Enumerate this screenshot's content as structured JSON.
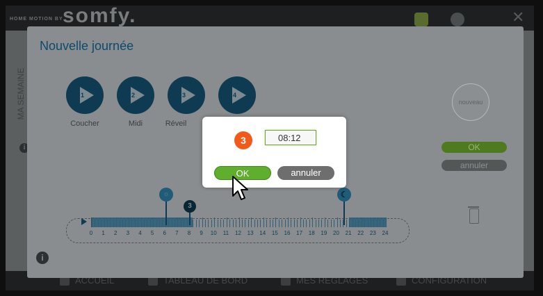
{
  "header": {
    "tagline": "HOME MOTION BY",
    "brand": "somfy."
  },
  "side_tab": "MA SEMAINE",
  "panel": {
    "title": "Nouvelle journée",
    "slots": [
      {
        "number": "1",
        "label": "Coucher"
      },
      {
        "number": "2",
        "label": "Midi"
      },
      {
        "number": "3",
        "label": "Réveil"
      },
      {
        "number": "4",
        "label": ""
      }
    ],
    "new_button": "nouveau",
    "ok_button": "OK",
    "cancel_button": "annuler",
    "timeline": {
      "hours": [
        "0",
        "1",
        "2",
        "3",
        "4",
        "5",
        "6",
        "7",
        "8",
        "9",
        "10",
        "11",
        "12",
        "13",
        "14",
        "15",
        "16",
        "17",
        "18",
        "19",
        "20",
        "21",
        "22",
        "23",
        "24"
      ],
      "markers": [
        {
          "type": "sun",
          "hour": 7.5
        },
        {
          "type": "step",
          "label": "3",
          "hour": 8.2
        },
        {
          "type": "moon",
          "hour": 21
        }
      ]
    }
  },
  "modal": {
    "step_number": "3",
    "time_value": "08:12",
    "ok_label": "OK",
    "cancel_label": "annuler"
  },
  "bottom_nav": [
    {
      "label": "ACCUEIL"
    },
    {
      "label": "TABLEAU DE BORD"
    },
    {
      "label": "MES RÉGLAGES"
    },
    {
      "label": "CONFIGURATION"
    }
  ],
  "colors": {
    "accent_orange": "#f25a1a",
    "ok_green": "#5fae2e",
    "dark_teal": "#0e3b52",
    "title_blue": "#0e4a6a"
  },
  "icons": [
    "info-icon",
    "trash-icon",
    "sun-icon",
    "moon-icon",
    "play-icon",
    "cursor-icon"
  ]
}
